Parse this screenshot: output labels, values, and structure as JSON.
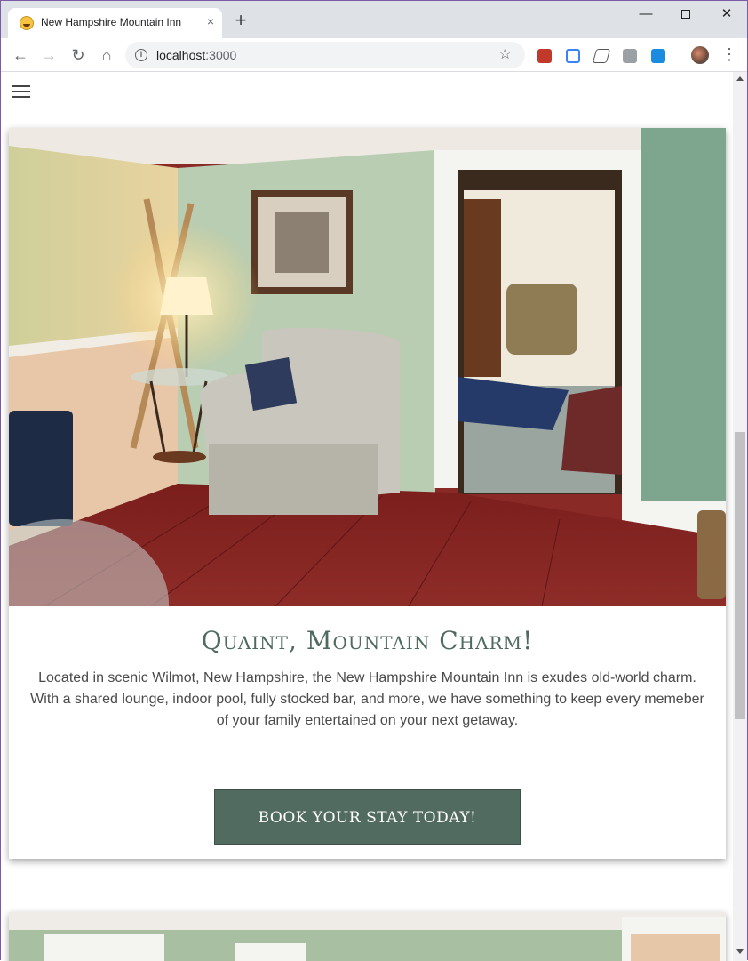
{
  "browser": {
    "tab_title": "New Hampshire Mountain Inn",
    "tab_close": "×",
    "new_tab": "+",
    "url_host": "localhost",
    "url_port": ":3000",
    "minimize": "—",
    "close": "✕",
    "back": "←",
    "forward": "→",
    "reload": "↻",
    "home": "⌂",
    "info": "i",
    "bookmark": "☆",
    "menu": "⋮"
  },
  "hero": {
    "photo_alt": "Sitting room with plaid armchair, lamp, and crossed skis",
    "title": "Quaint, Mountain Charm!",
    "body": "Located in scenic Wilmot, New Hampshire, the New Hampshire Mountain Inn is exudes old-world charm. With a shared lounge, indoor pool, fully stocked bar, and more, we have something to keep every memeber of your family entertained on your next getaway.",
    "cta": "BOOK YOUR STAY TODAY!"
  },
  "colors": {
    "accent": "#526b60",
    "title": "#4f6a5e"
  }
}
